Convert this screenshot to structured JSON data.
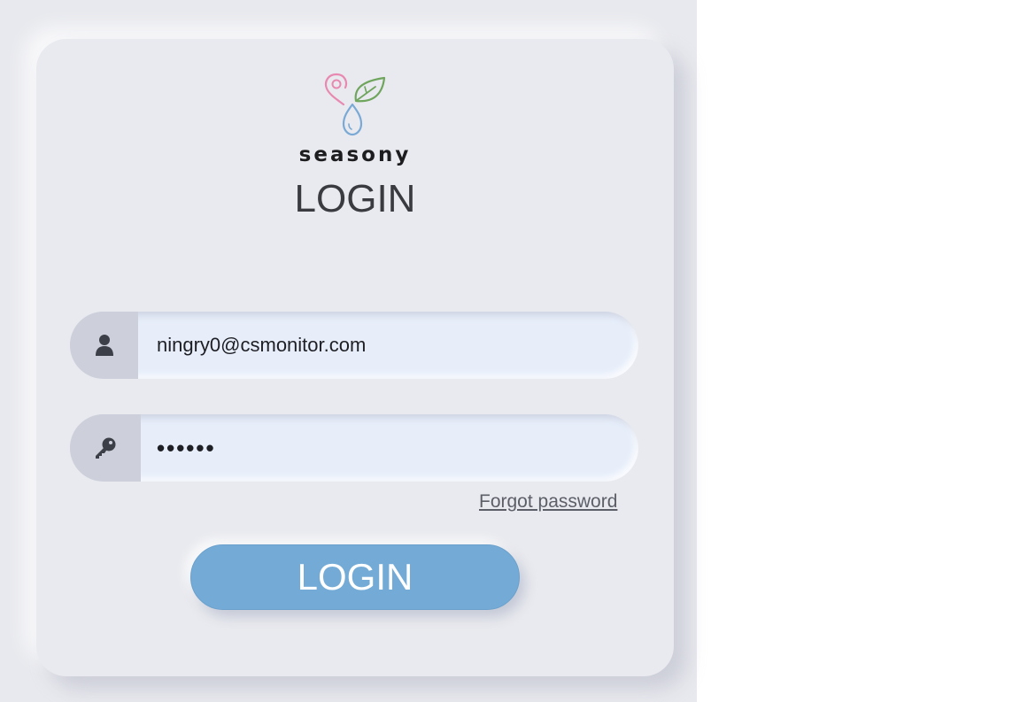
{
  "brand": {
    "name": "seasony"
  },
  "page": {
    "title": "LOGIN"
  },
  "email": {
    "value": "ningry0@csmonitor.com"
  },
  "password": {
    "masked_value": "••••••"
  },
  "links": {
    "forgot_password": "Forgot password"
  },
  "buttons": {
    "login": "LOGIN"
  },
  "icons": {
    "email": "user-icon",
    "password": "key-icon",
    "logo": "seasony-logo-icon"
  },
  "colors": {
    "accent": "#74abd6",
    "logo_pink": "#e889b2",
    "logo_green": "#6fa55d",
    "logo_blue": "#7aa9d6"
  }
}
